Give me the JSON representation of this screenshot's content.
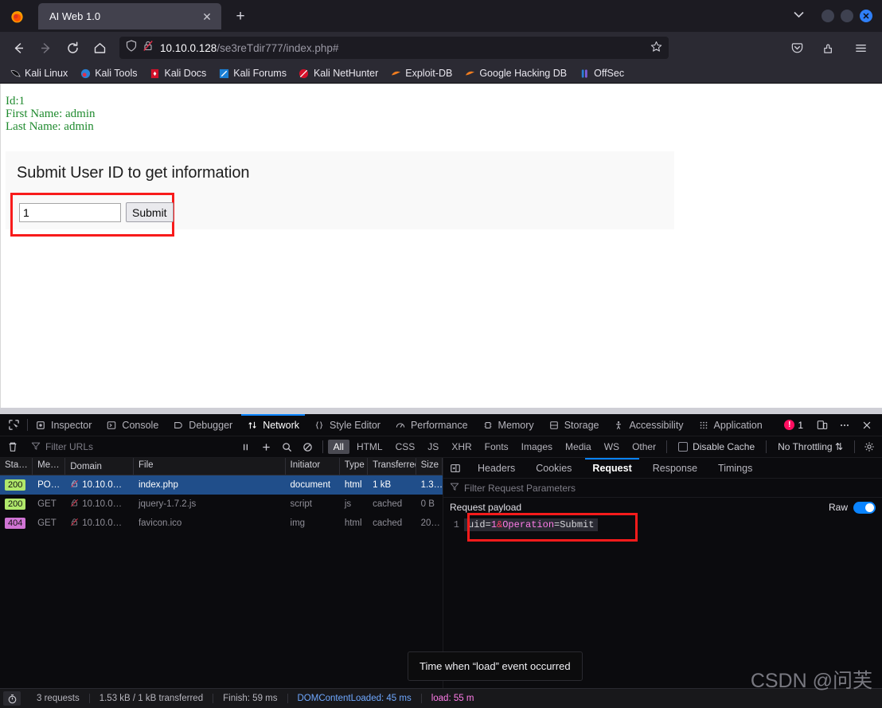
{
  "browser": {
    "tab": {
      "title": "AI Web 1.0",
      "close_label": "✕"
    },
    "newtab_label": "+",
    "tabstrip_chevron": "⌄",
    "window_close_label": "✕",
    "url": {
      "host": "10.10.0.128",
      "path": "/se3reTdir777/index.php#"
    },
    "nav": {
      "back": "back-arrow",
      "forward": "forward-arrow",
      "reload": "reload",
      "home": "home"
    },
    "bookmarks": [
      {
        "label": "Kali Linux",
        "icon": "kali-dragon-icon"
      },
      {
        "label": "Kali Tools",
        "icon": "kali-tools-icon"
      },
      {
        "label": "Kali Docs",
        "icon": "kali-docs-icon"
      },
      {
        "label": "Kali Forums",
        "icon": "kali-forums-icon"
      },
      {
        "label": "Kali NetHunter",
        "icon": "kali-nethunter-icon"
      },
      {
        "label": "Exploit-DB",
        "icon": "exploit-db-icon"
      },
      {
        "label": "Google Hacking DB",
        "icon": "google-hacking-db-icon"
      },
      {
        "label": "OffSec",
        "icon": "offsec-icon"
      }
    ]
  },
  "page": {
    "result": {
      "id_line": "Id:1",
      "first_name_line": "First Name: admin",
      "last_name_line": "Last Name: admin",
      "text_color": "#1f8a2e"
    },
    "form": {
      "heading": "Submit User ID to get information",
      "uid_value": "1",
      "uid_placeholder": "",
      "submit_label": "Submit",
      "highlight_color": "#f81b1b"
    }
  },
  "devtools": {
    "tabs": [
      {
        "label": "Inspector",
        "icon": "inspector-icon",
        "active": false
      },
      {
        "label": "Console",
        "icon": "console-icon",
        "active": false
      },
      {
        "label": "Debugger",
        "icon": "debugger-icon",
        "active": false
      },
      {
        "label": "Network",
        "icon": "network-icon",
        "active": true
      },
      {
        "label": "Style Editor",
        "icon": "style-editor-icon",
        "active": false
      },
      {
        "label": "Performance",
        "icon": "performance-icon",
        "active": false
      },
      {
        "label": "Memory",
        "icon": "memory-icon",
        "active": false
      },
      {
        "label": "Storage",
        "icon": "storage-icon",
        "active": false
      },
      {
        "label": "Accessibility",
        "icon": "accessibility-icon",
        "active": false
      },
      {
        "label": "Application",
        "icon": "application-icon",
        "active": false
      }
    ],
    "error_count": "1",
    "toolbar": {
      "filter_placeholder": "Filter URLs",
      "pause_label": "⏸",
      "add_label": "+",
      "search_label": "search-icon",
      "block_label": "block-icon",
      "types": [
        "All",
        "HTML",
        "CSS",
        "JS",
        "XHR",
        "Fonts",
        "Images",
        "Media",
        "WS",
        "Other"
      ],
      "active_type": "All",
      "disable_cache_label": "Disable Cache",
      "throttling_label": "No Throttling",
      "settings_label": "gear-icon"
    },
    "network": {
      "columns": [
        "Sta…",
        "Me…",
        "Domain",
        "File",
        "Initiator",
        "Type",
        "Transferred",
        "Size"
      ],
      "rows": [
        {
          "status": "200",
          "status_kind": "ok",
          "method": "PO…",
          "domain": "10.10.0…",
          "file": "index.php",
          "initiator": "document",
          "type": "html",
          "transferred": "1 kB",
          "size": "1.3…",
          "selected": true
        },
        {
          "status": "200",
          "status_kind": "ok",
          "method": "GET",
          "domain": "10.10.0…",
          "file": "jquery-1.7.2.js",
          "initiator": "script",
          "type": "js",
          "transferred": "cached",
          "size": "0 B",
          "selected": false
        },
        {
          "status": "404",
          "status_kind": "nf",
          "method": "GET",
          "domain": "10.10.0…",
          "file": "favicon.ico",
          "initiator": "img",
          "type": "html",
          "transferred": "cached",
          "size": "20…",
          "selected": false
        }
      ]
    },
    "request_panel": {
      "tabs": [
        "Headers",
        "Cookies",
        "Request",
        "Response",
        "Timings"
      ],
      "active_tab": "Request",
      "filter_placeholder": "Filter Request Parameters",
      "payload_label": "Request payload",
      "raw_label": "Raw",
      "raw_on": true,
      "line_number": "1",
      "payload": {
        "full": "uid=1&Operation=Submit",
        "prefix": "uid=",
        "value": "1",
        "amp": "&",
        "key2": "Operation",
        "suffix": "=Submit"
      },
      "highlight_color": "#f81b1b"
    },
    "status": {
      "requests": "3 requests",
      "transferred": "1.53 kB / 1 kB transferred",
      "finish": "Finish: 59 ms",
      "dom_content_loaded": "DOMContentLoaded: 45 ms",
      "load": "load: 55 m"
    }
  },
  "tooltip": {
    "text": "Time when “load” event occurred"
  },
  "watermark": {
    "text": "CSDN @问芙"
  }
}
